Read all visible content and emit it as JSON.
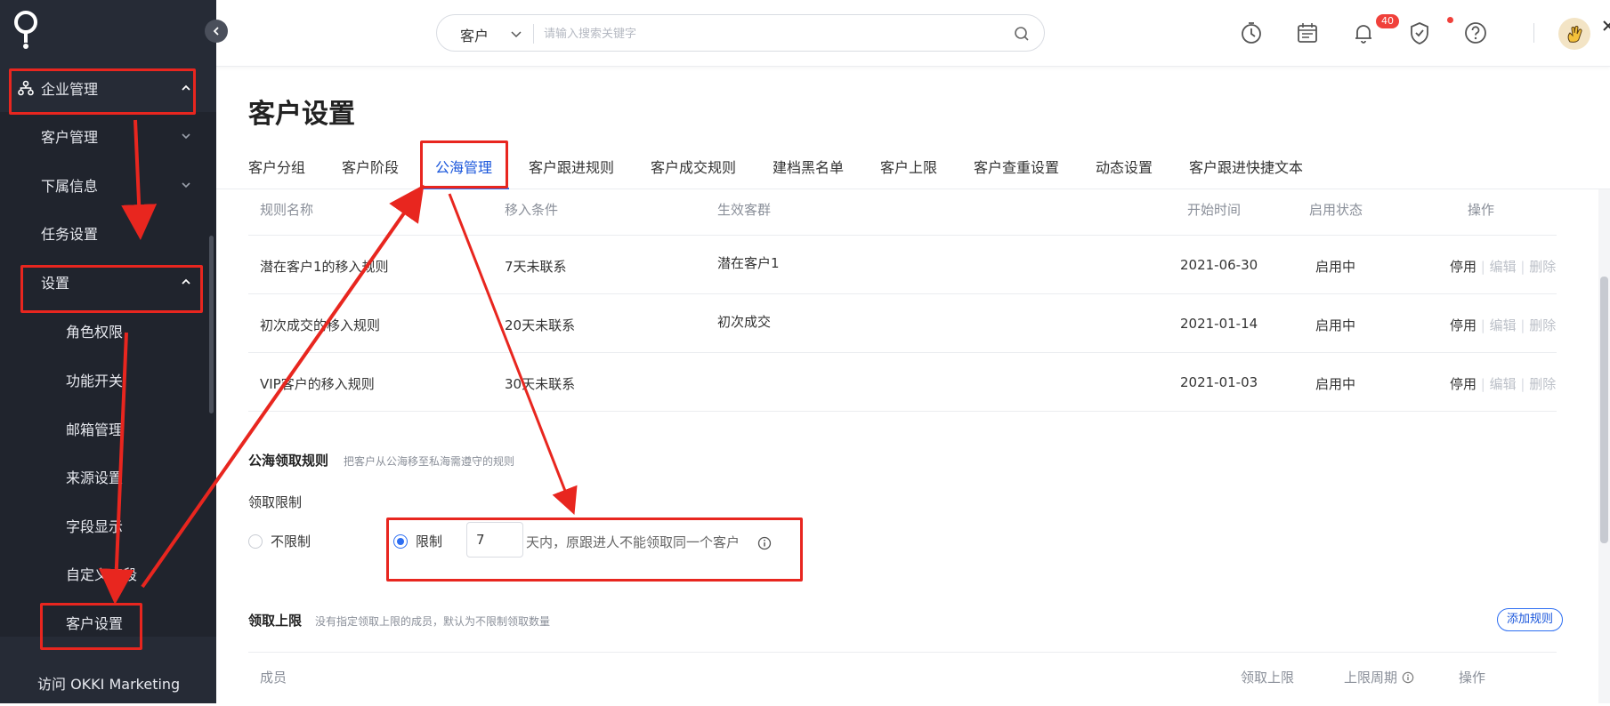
{
  "sidebar": {
    "items": [
      {
        "label": "企业管理",
        "expanded": true
      },
      {
        "label": "客户管理"
      },
      {
        "label": "下属信息"
      },
      {
        "label": "任务设置"
      },
      {
        "label": "设置",
        "expanded": true
      },
      {
        "label": "角色权限"
      },
      {
        "label": "功能开关"
      },
      {
        "label": "邮箱管理"
      },
      {
        "label": "来源设置"
      },
      {
        "label": "字段显示"
      },
      {
        "label": "自定义字段"
      },
      {
        "label": "客户设置",
        "active": true
      },
      {
        "label": "访问 OKKI Marketing"
      }
    ]
  },
  "header": {
    "search_type": "客户",
    "search_placeholder": "请输入搜索关键字",
    "notification_count": "40"
  },
  "page": {
    "title": "客户设置",
    "tabs": [
      "客户分组",
      "客户阶段",
      "公海管理",
      "客户跟进规则",
      "客户成交规则",
      "建档黑名单",
      "客户上限",
      "客户查重设置",
      "动态设置",
      "客户跟进快捷文本"
    ],
    "active_tab": "公海管理"
  },
  "rules_table": {
    "headers": [
      "规则名称",
      "移入条件",
      "生效客群",
      "开始时间",
      "启用状态",
      "操作"
    ],
    "rows": [
      {
        "name": "潜在客户1的移入规则",
        "condition": "7天未联系",
        "group": "潜在客户1",
        "start": "2021-06-30",
        "status": "启用中"
      },
      {
        "name": "初次成交的移入规则",
        "condition": "20天未联系",
        "group": "初次成交",
        "start": "2021-01-14",
        "status": "启用中"
      },
      {
        "name": "VIP客户的移入规则",
        "condition": "30天未联系",
        "group": "",
        "start": "2021-01-03",
        "status": "启用中"
      }
    ],
    "actions": {
      "disable": "停用",
      "edit": "编辑",
      "delete": "删除"
    }
  },
  "claim_rules": {
    "title": "公海领取规则",
    "desc": "把客户从公海移至私海需遵守的规则",
    "limit_label": "领取限制",
    "option_unlimited": "不限制",
    "option_limited": "限制",
    "days_value": "7",
    "limit_text": "天内，原跟进人不能领取同一个客户",
    "selected": "limited"
  },
  "claim_cap": {
    "title": "领取上限",
    "desc": "没有指定领取上限的成员，默认为不限制领取数量",
    "add_button": "添加规则",
    "headers": [
      "成员",
      "领取上限",
      "上限周期",
      "操作"
    ]
  },
  "colors": {
    "sidebar_bg": "#262b36",
    "accent": "#2d6ef2",
    "annotation_red": "#e8261f",
    "badge_red": "#f0413b"
  }
}
